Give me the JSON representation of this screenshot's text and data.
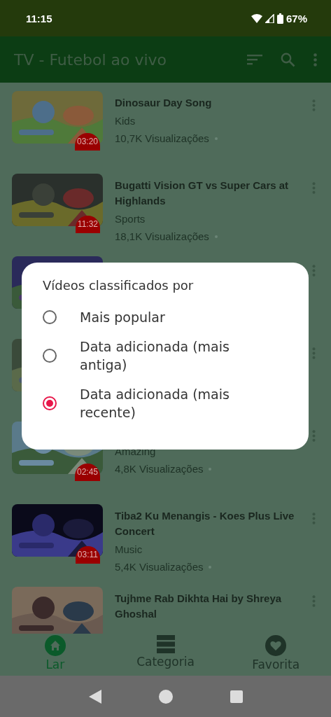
{
  "status_bar": {
    "time": "11:15",
    "battery": "67%"
  },
  "app_bar": {
    "title": "TV - Futebol ao vivo"
  },
  "videos": [
    {
      "kind": "video",
      "title": "Dinosaur Day Song",
      "category": "Kids",
      "views": "10,7K Visualizações",
      "duration": "03:20"
    },
    {
      "kind": "video",
      "title": "Bugatti Vision GT vs Super Cars at Highlands",
      "category": "Sports",
      "views": "18,1K Visualizações",
      "duration": "11:32"
    },
    {
      "kind": "covered"
    },
    {
      "kind": "covered"
    },
    {
      "kind": "video",
      "category": "Amazing",
      "views": "4,8K Visualizações",
      "duration": "02:45"
    },
    {
      "kind": "video",
      "title": "Tiba2 Ku Menangis - Koes Plus Live Concert",
      "category": "Music",
      "views": "5,4K Visualizações",
      "duration": "03:11"
    },
    {
      "kind": "video",
      "title": "Tujhme Rab Dikhta Hai by Shreya Ghoshal"
    }
  ],
  "dialog": {
    "title": "Vídeos classificados por",
    "options": [
      {
        "label": "Mais popular",
        "selected": false
      },
      {
        "label": "Data adicionada (mais antiga)",
        "selected": false
      },
      {
        "label": "Data adicionada (mais recente)",
        "selected": true
      }
    ]
  },
  "bottom_nav": [
    {
      "label": "Lar",
      "selected": true
    },
    {
      "label": "Categoria",
      "selected": false
    },
    {
      "label": "Favorita",
      "selected": false
    }
  ]
}
